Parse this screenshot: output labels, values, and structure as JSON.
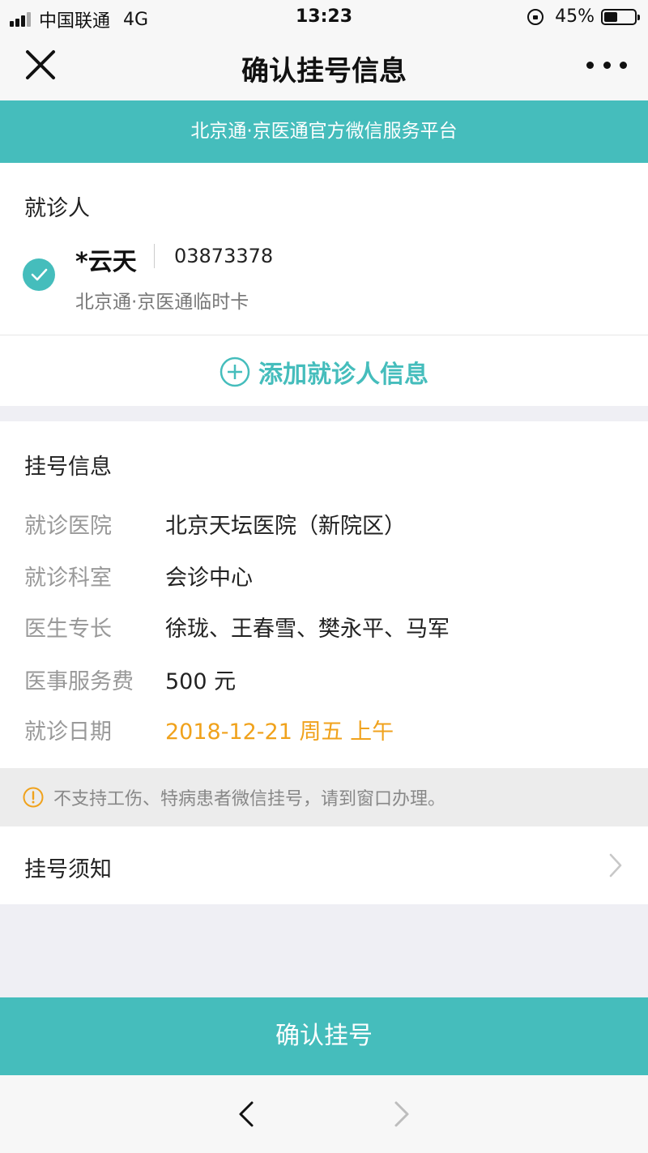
{
  "status_bar": {
    "carrier": "中国联通",
    "network": "4G",
    "time": "13:23",
    "battery_percent": "45%",
    "battery_level": 0.45
  },
  "nav": {
    "title": "确认挂号信息",
    "close_icon": "close-icon",
    "more_icon": "more-icon"
  },
  "banner": {
    "text": "北京通·京医通官方微信服务平台"
  },
  "patient": {
    "section_title": "就诊人",
    "name": "*云天",
    "id": "03873378",
    "card_type": "北京通·京医通临时卡",
    "add_label": "添加就诊人信息"
  },
  "registration": {
    "section_title": "挂号信息",
    "rows": [
      {
        "label": "就诊医院",
        "value": "北京天坛医院（新院区）"
      },
      {
        "label": "就诊科室",
        "value": "会诊中心"
      },
      {
        "label": "医生专长",
        "value": "徐珑、王春雪、樊永平、马军"
      },
      {
        "label": "医事服务费",
        "value": "500 元"
      },
      {
        "label": "就诊日期",
        "value": "2018-12-21 周五 上午"
      }
    ]
  },
  "notice": {
    "text": "不支持工伤、特病患者微信挂号，请到窗口办理。"
  },
  "rules": {
    "label": "挂号须知"
  },
  "confirm": {
    "label": "确认挂号"
  },
  "colors": {
    "accent": "#45bdbc",
    "date": "#f0a21c",
    "notice_icon": "#f0a21c"
  }
}
